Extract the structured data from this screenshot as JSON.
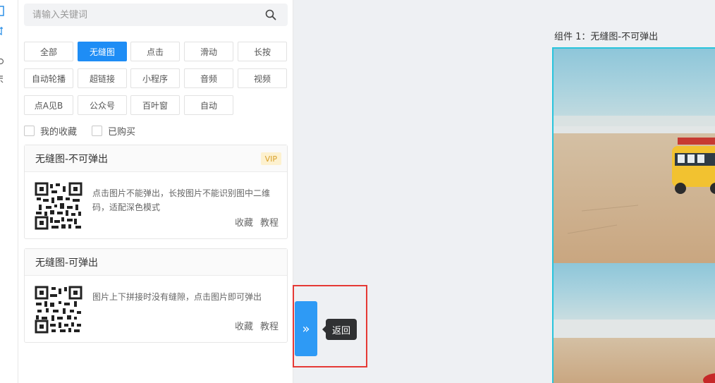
{
  "search": {
    "placeholder": "请输入关键词"
  },
  "tags": [
    "全部",
    "无缝图",
    "点击",
    "滑动",
    "长按",
    "自动轮播",
    "超链接",
    "小程序",
    "音频",
    "视频",
    "点A见B",
    "公众号",
    "百叶窗",
    "自动"
  ],
  "active_tag": "无缝图",
  "filters": {
    "favorites": "我的收藏",
    "purchased": "已购买"
  },
  "cards": [
    {
      "title": "无缝图-不可弹出",
      "badge": "VIP",
      "description": "点击图片不能弹出，长按图片不能识别图中二维码，适配深色模式",
      "favorite": "收藏",
      "tutorial": "教程"
    },
    {
      "title": "无缝图-可弹出",
      "badge": "",
      "description": "图片上下拼接时没有缝隙，点击图片即可弹出",
      "favorite": "收藏",
      "tutorial": "教程"
    }
  ],
  "canvas": {
    "component_label": "组件 1：无缝图-不可弹出"
  },
  "toggle": {
    "glyph": "»",
    "tooltip": "返回"
  },
  "colors": {
    "accent": "#1e8df5",
    "preview_border": "#28c4dc",
    "highlight": "#e53935",
    "vip_bg": "#fdf1cf",
    "vip_text": "#d8a02b"
  }
}
